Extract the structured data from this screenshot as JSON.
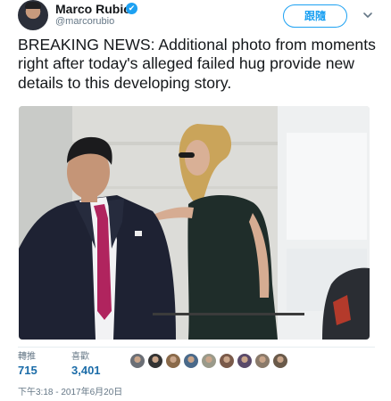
{
  "user": {
    "display_name": "Marco Rubio",
    "handle": "@marcorubio",
    "verified_icon": "✔"
  },
  "follow_button_label": "跟隨",
  "tweet": {
    "text": "BREAKING NEWS: Additional photo from moments right after today's alleged failed hug provide new details to this developing story."
  },
  "stats": {
    "retweets_label": "轉推",
    "retweets_value": "715",
    "likes_label": "喜歡",
    "likes_value": "3,401",
    "liker_avatar_colors": [
      "#6b6f76",
      "#333333",
      "#8a6a4a",
      "#4a6a8a",
      "#9a9a8a",
      "#7a5a4a",
      "#5a4a6a",
      "#8a7a6a",
      "#6a5a4a"
    ]
  },
  "timestamp": "下午3:18 - 2017年6月20日",
  "colors": {
    "accent": "#1da1f2",
    "stat_value": "#1b6ca8",
    "secondary_text": "#657786"
  }
}
